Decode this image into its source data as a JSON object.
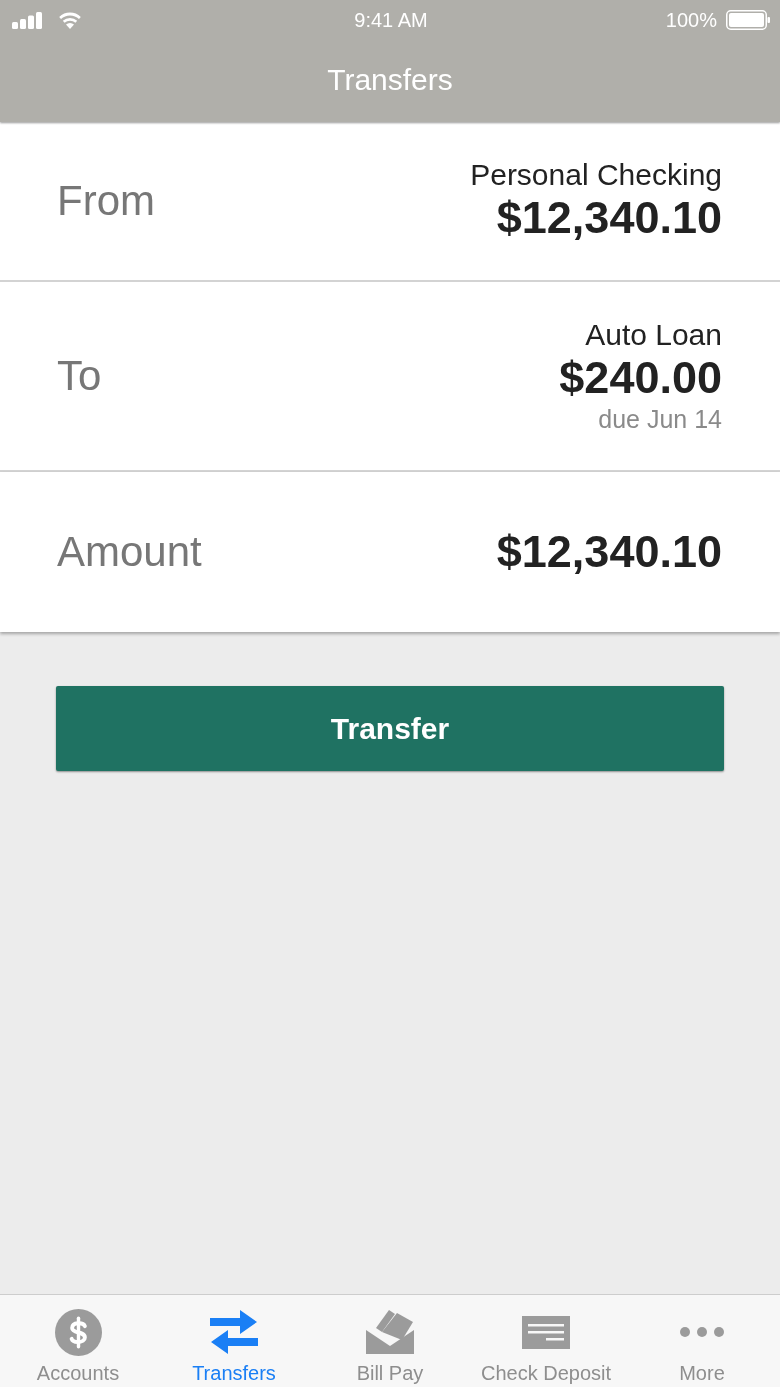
{
  "status_bar": {
    "time": "9:41 AM",
    "battery": "100%"
  },
  "nav_bar": {
    "title": "Transfers"
  },
  "transfer_form": {
    "rows": [
      {
        "label": "From",
        "account_name": "Personal Checking",
        "amount": "$12,340.10"
      },
      {
        "label": "To",
        "account_name": "Auto Loan",
        "amount": "$240.00",
        "due": "due Jun 14"
      },
      {
        "label": "Amount",
        "amount": "$12,340.10"
      }
    ]
  },
  "transfer_button": {
    "label": "Transfer"
  },
  "tab_bar": {
    "tabs": [
      {
        "label": "Accounts",
        "selected": false
      },
      {
        "label": "Transfers",
        "selected": true
      },
      {
        "label": "Bill Pay",
        "selected": false
      },
      {
        "label": "Check Deposit",
        "selected": false
      },
      {
        "label": "More",
        "selected": false
      }
    ]
  }
}
